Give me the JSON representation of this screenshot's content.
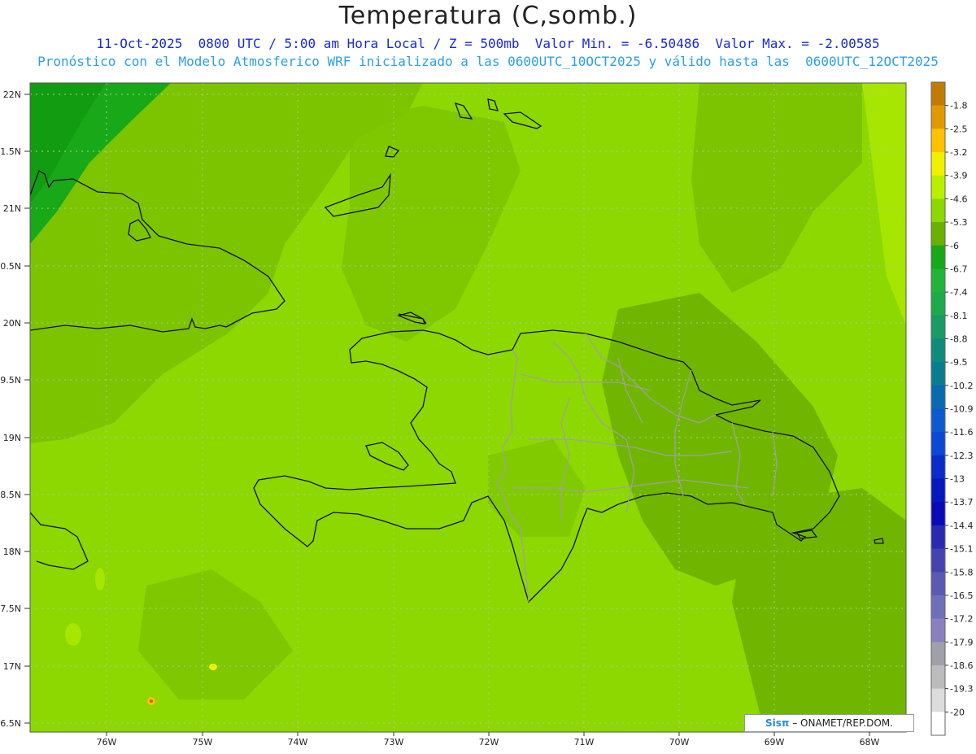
{
  "header": {
    "title": "Temperatura (C,somb.)",
    "subtitle_line1": "11-Oct-2025  0800 UTC / 5:00 am Hora Local / Z = 500mb  Valor Min. = -6.50486  Valor Max. = -2.00585",
    "subtitle_line2": "Pronóstico con el Modelo Atmosferico WRF inicializado a las 0600UTC_10OCT2025 y válido hasta las  0600UTC_12OCT2025"
  },
  "map": {
    "lat_labels": [
      "22N",
      "1.5N",
      "21N",
      "0.5N",
      "20N",
      "9.5N",
      "19N",
      "8.5N",
      "18N",
      "7.5N",
      "17N",
      "6.5N"
    ],
    "lon_labels": [
      "76W",
      "75W",
      "74W",
      "73W",
      "72W",
      "71W",
      "70W",
      "69W",
      "68W"
    ],
    "regions": [
      "Cuba",
      "Haiti",
      "Dominican Republic",
      "Bahamas",
      "Turks and Caicos",
      "Jamaica"
    ]
  },
  "legend": {
    "values": [
      "-1.8",
      "-2.5",
      "-3.2",
      "-3.9",
      "-4.6",
      "-5.3",
      "-6",
      "-6.7",
      "-7.4",
      "-8.1",
      "-8.8",
      "-9.5",
      "-10.2",
      "-10.9",
      "-11.6",
      "-12.3",
      "-13",
      "-13.7",
      "-14.4",
      "-15.1",
      "-15.8",
      "-16.5",
      "-17.2",
      "-17.9",
      "-18.6",
      "-19.3",
      "-20"
    ],
    "colors": [
      "#c07c00",
      "#e09a00",
      "#fcc200",
      "#f0f000",
      "#b8f000",
      "#8cd800",
      "#6ab000",
      "#18a818",
      "#22b43a",
      "#1eaa4a",
      "#1a9a66",
      "#108a7a",
      "#0a7c90",
      "#0a6ab0",
      "#0c5ad0",
      "#0c48d4",
      "#0a2cc8",
      "#0818c0",
      "#0a0ab8",
      "#2a2ab0",
      "#4444b0",
      "#5a5ab0",
      "#7070b8",
      "#8a80c0",
      "#a0a0a8",
      "#bcbcbc",
      "#dcdcdc",
      "#ffffff"
    ]
  },
  "credit": {
    "sis": "Sisπ",
    "text": " – ONAMET/REP.DOM."
  }
}
